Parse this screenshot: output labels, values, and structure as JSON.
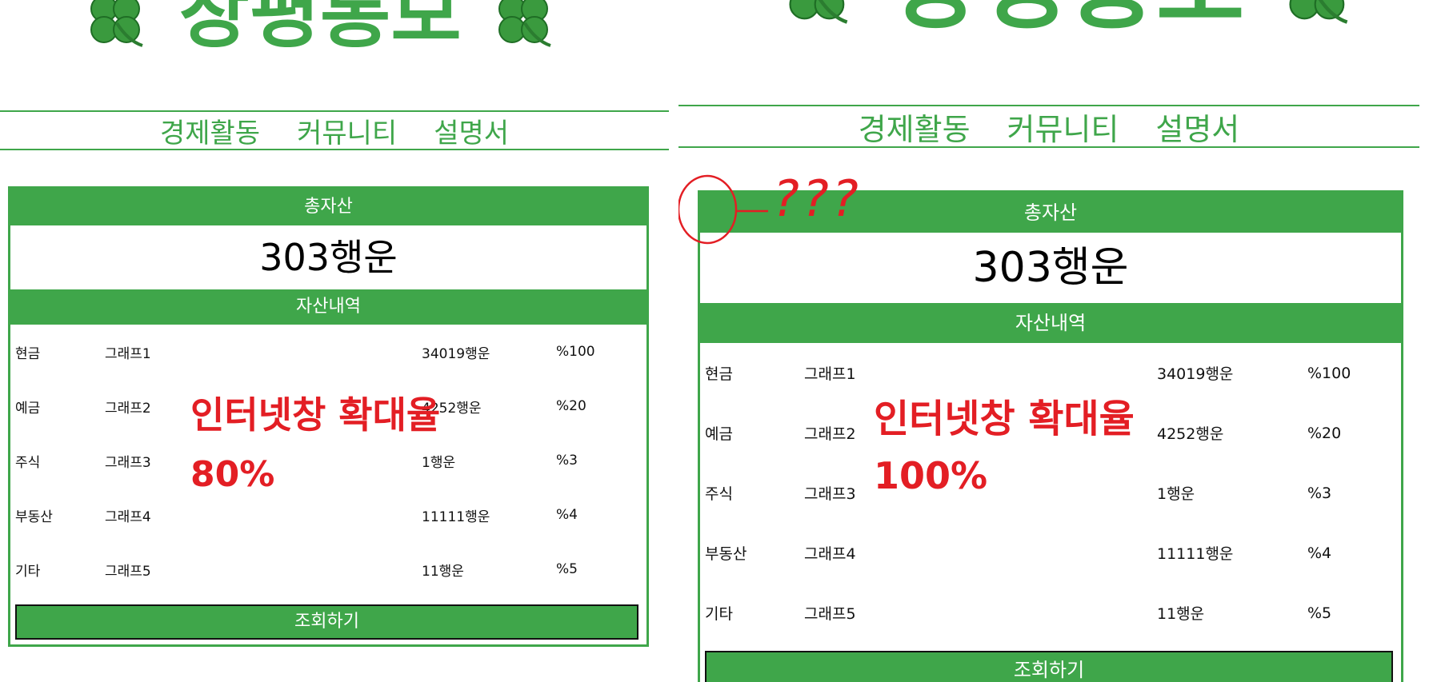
{
  "header": {
    "title": "창평통보",
    "nav": [
      "경제활동",
      "커뮤니티",
      "설명서"
    ]
  },
  "summary": {
    "total_label": "총자산",
    "total_value": "303행운",
    "section_label": "자산내역",
    "query_button": "조회하기"
  },
  "assets": [
    {
      "name": "현금",
      "graph": "그래프1",
      "amount": "34019행운",
      "percent": "%100"
    },
    {
      "name": "예금",
      "graph": "그래프2",
      "amount": "4252행운",
      "percent": "%20"
    },
    {
      "name": "주식",
      "graph": "그래프3",
      "amount": "1행운",
      "percent": "%3"
    },
    {
      "name": "부동산",
      "graph": "그래프4",
      "amount": "11111행운",
      "percent": "%4"
    },
    {
      "name": "기타",
      "graph": "그래프5",
      "amount": "11행운",
      "percent": "%5"
    }
  ],
  "annotations": {
    "zoom_label": "인터넷창 확대율",
    "zoom_80": "80%",
    "zoom_100": "100%",
    "question_marks": "???"
  },
  "colors": {
    "accent": "#3fa64a",
    "annotation": "#e31e24"
  }
}
